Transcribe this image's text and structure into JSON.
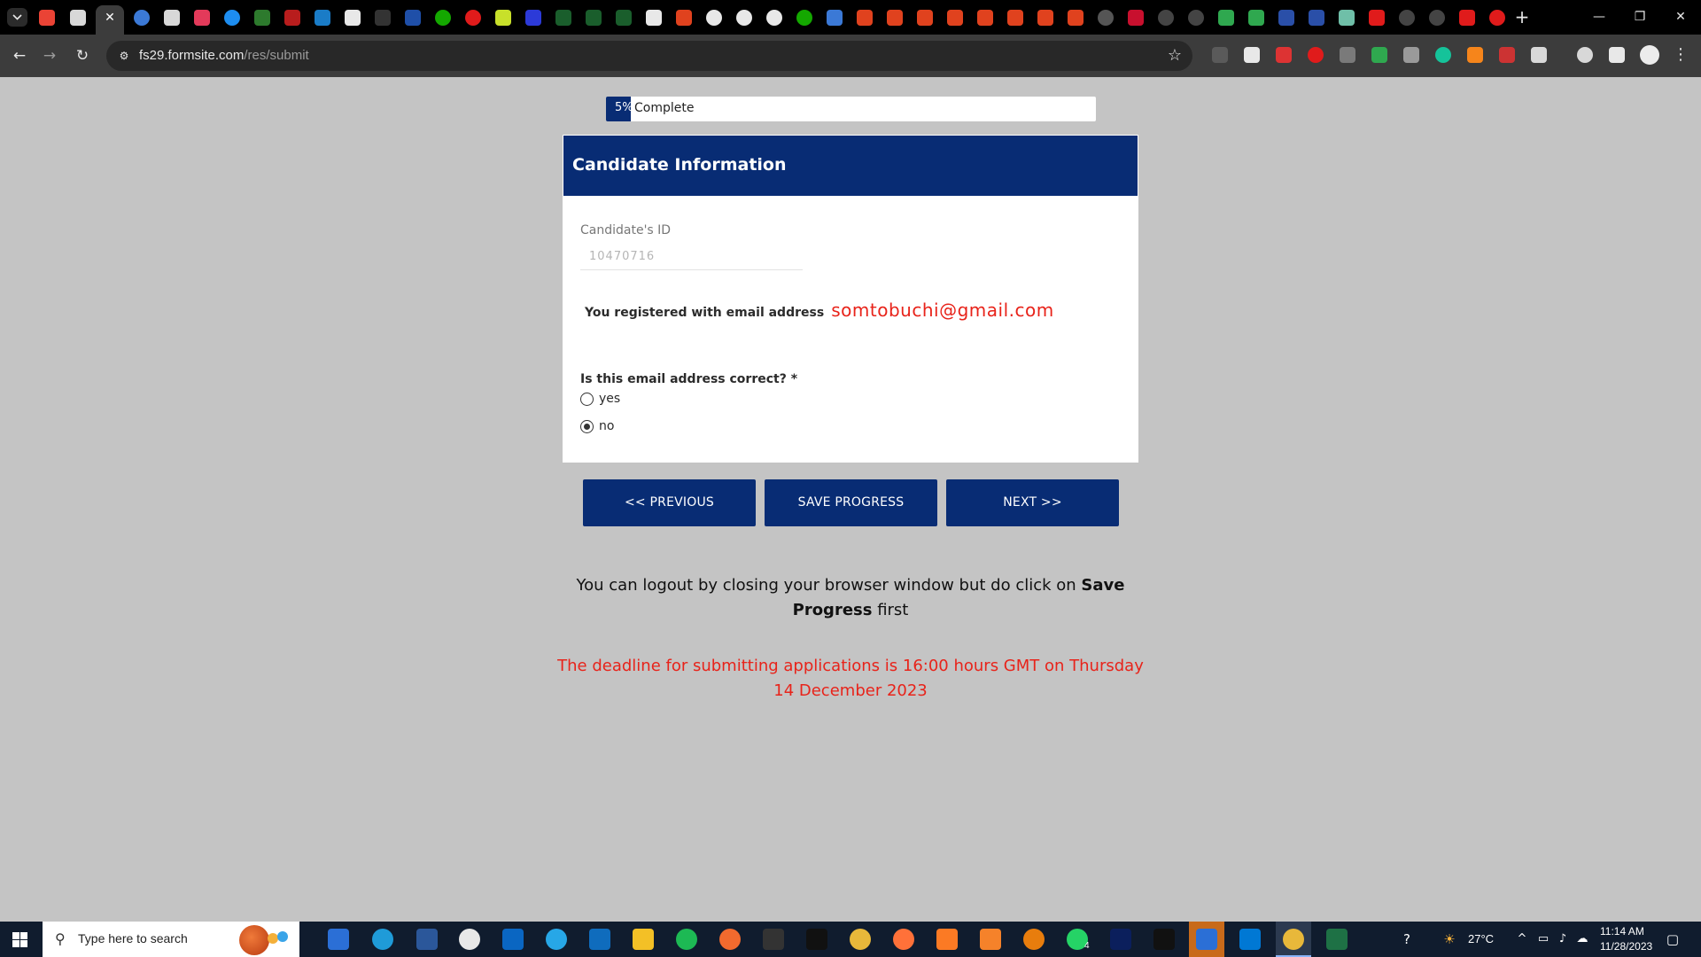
{
  "browser": {
    "url_host": "fs29.formsite.com",
    "url_path": "/res/submit",
    "new_tab_glyph": "+",
    "window_controls": {
      "minimize": "—",
      "restore": "❐",
      "close": "✕"
    }
  },
  "progress": {
    "percent_text": "5%",
    "label": "Complete",
    "value": 5
  },
  "form": {
    "section_title": "Candidate Information",
    "candidate_id_label": "Candidate's ID",
    "candidate_id_value": "10470716",
    "email_prefix": "You registered with email address",
    "email_value": "somtobuchi@gmail.com",
    "question": "Is this email address correct? *",
    "options": [
      {
        "label": "yes",
        "checked": false
      },
      {
        "label": "no",
        "checked": true
      }
    ]
  },
  "buttons": {
    "previous": "<< PREVIOUS",
    "save": "SAVE PROGRESS",
    "next": "NEXT >>"
  },
  "note": {
    "before": "You can logout by closing your browser window but do click on ",
    "bold": "Save Progress",
    "after": " first"
  },
  "deadline": "The deadline for submitting applications is 16:00 hours GMT on Thursday 14 December 2023",
  "taskbar": {
    "search_placeholder": "Type here to search",
    "temperature": "27°C",
    "time": "11:14 AM",
    "date": "11/28/2023",
    "whatsapp_badge": "4"
  },
  "colors": {
    "brand": "#082c74",
    "alert": "#e8231a",
    "page_bg": "#c4c4c4"
  }
}
